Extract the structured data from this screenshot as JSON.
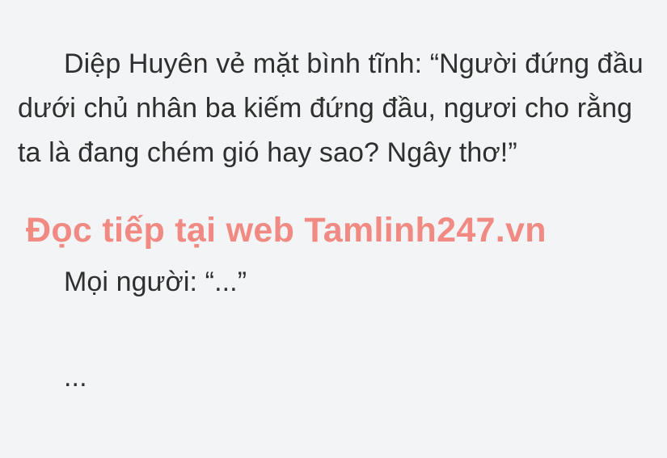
{
  "document": {
    "paragraphs": [
      "Diệp Huyên vẻ mặt bình tĩnh: “Người đứng đầu dưới chủ nhân ba kiếm đứng đầu, ngươi cho rằng ta là đang chém gió hay sao? Ngây thơ!”",
      "Mọi người: “...”",
      "..."
    ],
    "watermark": "Đọc tiếp tại web Tamlinh247.vn"
  },
  "colors": {
    "background": "#f3f4f6",
    "text": "#2f2f2f",
    "watermark": "#f08a82"
  }
}
